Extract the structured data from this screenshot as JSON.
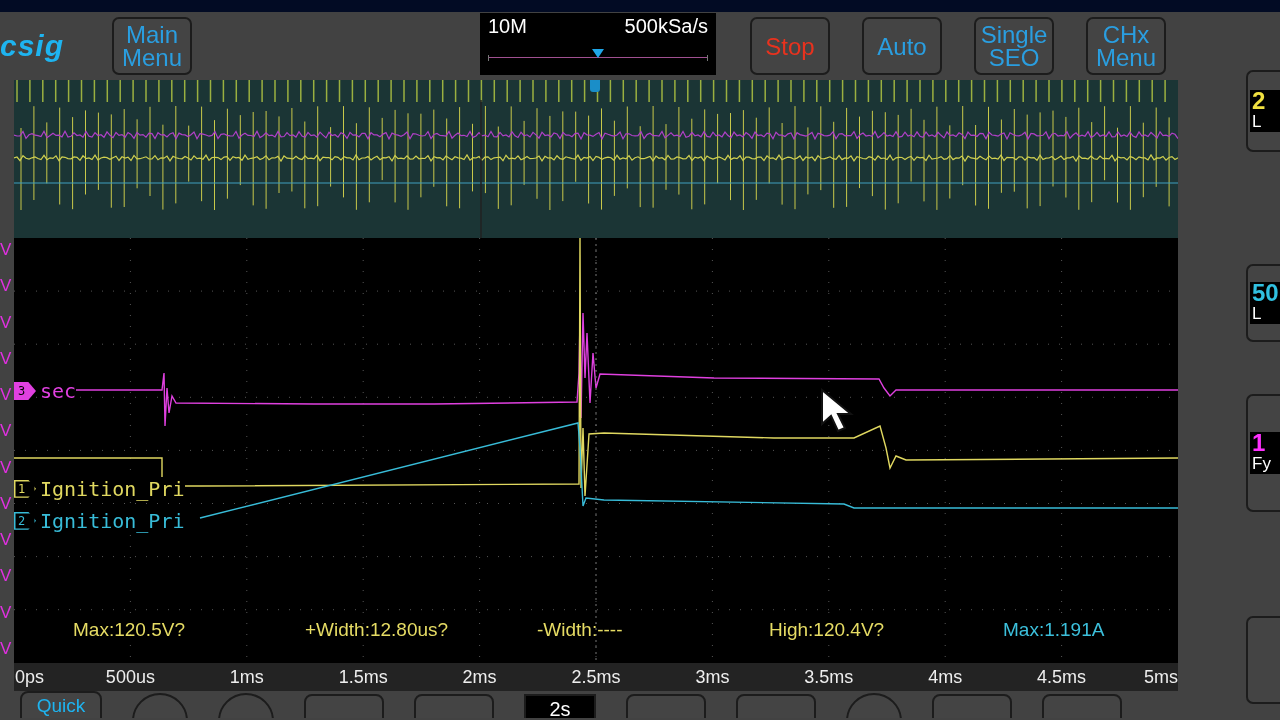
{
  "toolbar": {
    "logo": "csig",
    "memory": {
      "depth": "10M",
      "rate": "500kSa/s",
      "level": 0.5
    },
    "buttons": [
      {
        "label": "Main Menu",
        "color": "#2a9ee0"
      },
      {
        "label": "Stop",
        "color": "#e8321e"
      },
      {
        "label": "Auto",
        "color": "#2a9ee0"
      },
      {
        "label": "Single SEO",
        "color": "#2a9ee0"
      },
      {
        "label": "CHx Menu",
        "color": "#2a9ee0"
      }
    ]
  },
  "scale_labels": [
    "V",
    "V",
    "V",
    "V",
    "V",
    "V",
    "V",
    "V",
    "V",
    "V",
    "V",
    "V"
  ],
  "channels": [
    {
      "number": "3",
      "name": "sec",
      "color": "#e040e0",
      "selected": true
    },
    {
      "number": "1",
      "name": "Ignition_Pri",
      "color": "#e0d860",
      "selected": false
    },
    {
      "number": "2",
      "name": "Ignition_Pri",
      "color": "#38bcd8",
      "selected": false
    }
  ],
  "measurements": [
    {
      "text": "Max:120.5V?",
      "color": "#e6dc64"
    },
    {
      "text": "+Width:12.80us?",
      "color": "#e6dc64"
    },
    {
      "text": "-Width:----",
      "color": "#e6dc64"
    },
    {
      "text": "High:120.4V?",
      "color": "#e6dc64"
    },
    {
      "text": "Max:1.191A",
      "color": "#3cc0dc"
    }
  ],
  "time_axis": [
    "0ps",
    "500us",
    "1ms",
    "1.5ms",
    "2ms",
    "2.5ms",
    "3ms",
    "3.5ms",
    "4ms",
    "4.5ms",
    "5ms"
  ],
  "bottom_buttons": [
    {
      "kind": "text",
      "label": "Quick"
    },
    {
      "kind": "round"
    },
    {
      "kind": "round"
    },
    {
      "kind": "rect"
    },
    {
      "kind": "rect"
    },
    {
      "kind": "value",
      "label": "2s"
    },
    {
      "kind": "rect"
    },
    {
      "kind": "rect"
    },
    {
      "kind": "round"
    },
    {
      "kind": "rect"
    },
    {
      "kind": "rect"
    }
  ],
  "side_panel": [
    {
      "value": "2",
      "unit": "L",
      "color": "#f0e040"
    },
    {
      "value": "50",
      "unit": "L",
      "color": "#30c0e0"
    },
    {
      "value": "1",
      "unit": "Fy",
      "color": "#ff30ff"
    }
  ]
}
